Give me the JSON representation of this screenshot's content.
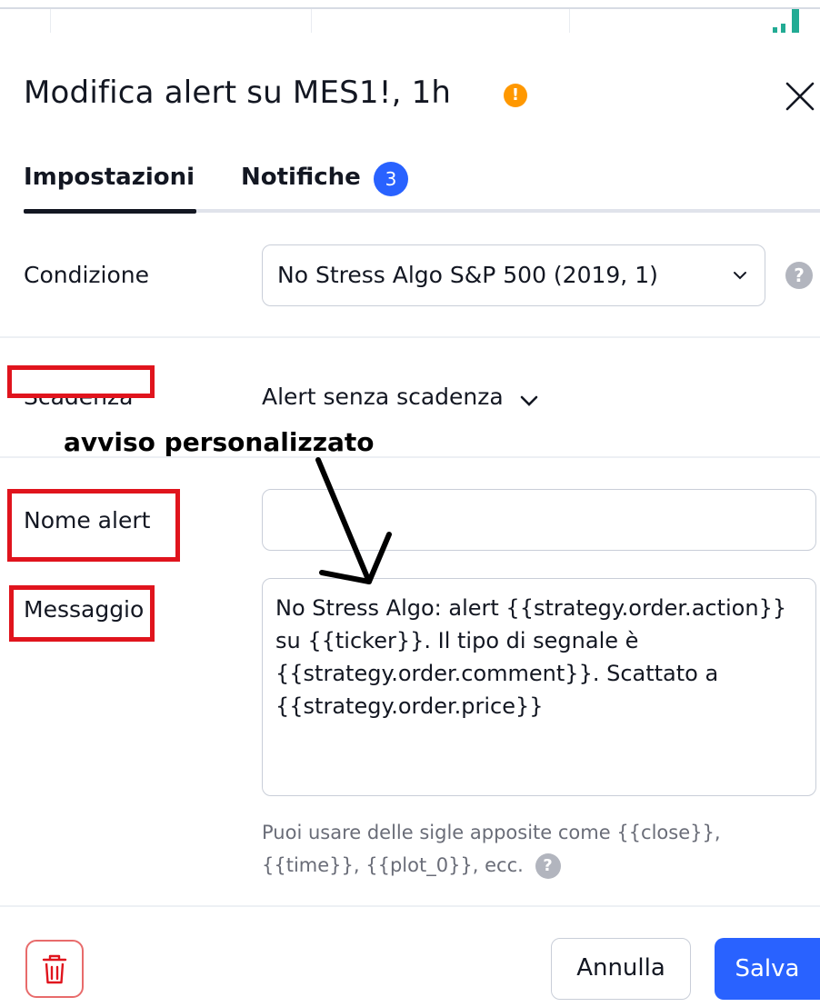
{
  "dialog": {
    "title": "Modifica alert su MES1!, 1h",
    "warning_icon": "exclamation-circle-icon",
    "close_icon": "close-icon"
  },
  "tabs": [
    {
      "label": "Impostazioni",
      "active": true
    },
    {
      "label": "Notifiche",
      "active": false,
      "badge": "3"
    }
  ],
  "form": {
    "condition_label": "Condizione",
    "condition_value": "No Stress Algo S&P 500 (2019, 1)",
    "expiry_label": "Scadenza",
    "expiry_value": "Alert senza scadenza",
    "name_label": "Nome alert",
    "name_value": "",
    "message_label": "Messaggio",
    "message_value": "No Stress Algo: alert {{strategy.order.action}} su {{ticker}}. Il tipo di segnale è {{strategy.order.comment}}. Scattato a {{strategy.order.price}}",
    "hint": "Puoi usare delle sigle apposite come {{close}}, {{time}}, {{plot_0}}, ecc."
  },
  "footer": {
    "delete_icon": "trash-icon",
    "cancel_label": "Annulla",
    "save_label": "Salva"
  },
  "annotation": {
    "text": "avviso personalizzato"
  },
  "colors": {
    "accent": "#2962ff",
    "warning": "#ff9800",
    "annotation_red": "#e0141d",
    "chart_bar": "#22ab94"
  }
}
